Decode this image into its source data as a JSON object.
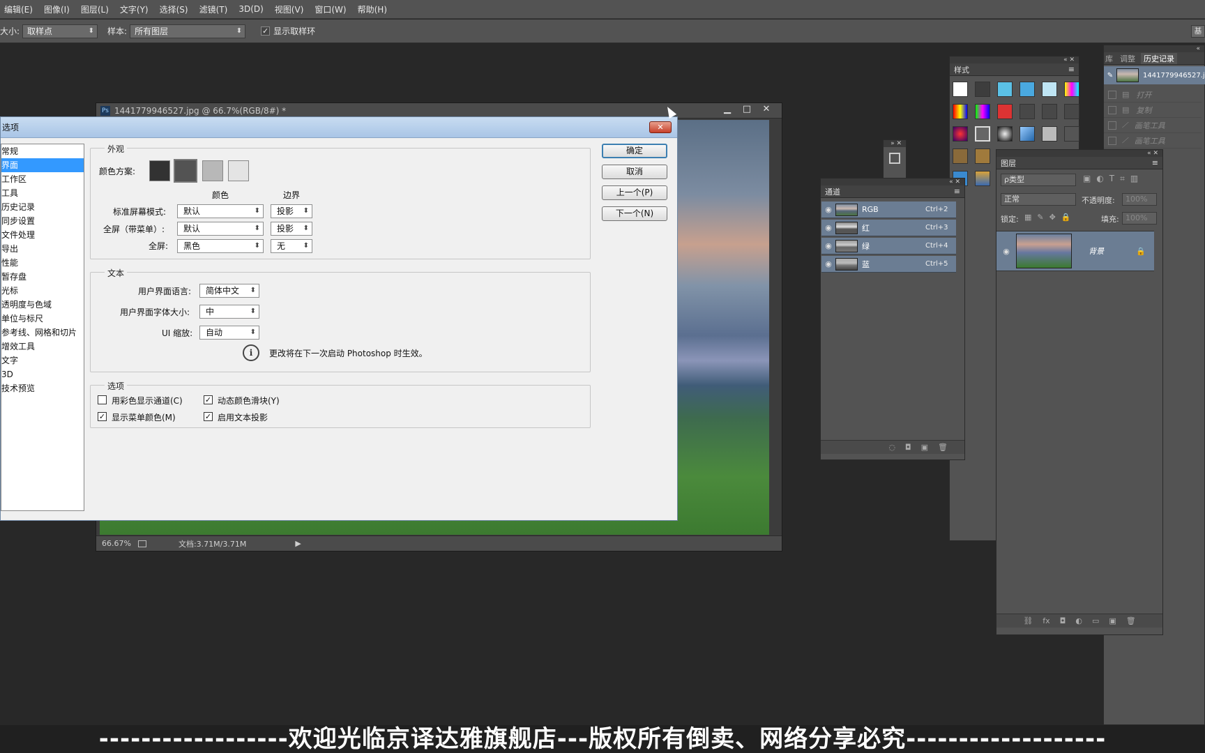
{
  "menu": [
    "编辑(E)",
    "图像(I)",
    "图层(L)",
    "文字(Y)",
    "选择(S)",
    "滤镜(T)",
    "3D(D)",
    "视图(V)",
    "窗口(W)",
    "帮助(H)"
  ],
  "options_bar": {
    "size_label": "大小:",
    "size_value": "取样点",
    "sample_label": "样本:",
    "sample_value": "所有图层",
    "show_ring_label": "显示取样环",
    "show_ring_checked": "✓",
    "right_btn": "基"
  },
  "document": {
    "title": "1441779946527.jpg @ 66.7%(RGB/8#) *",
    "ps_icon": "Ps",
    "minimize": "▁",
    "maximize": "□",
    "close": "✕",
    "zoom": "66.67%",
    "doc_size": "文档:3.71M/3.71M",
    "arrow": "▶"
  },
  "dialog": {
    "title": "选项",
    "close": "✕",
    "categories": [
      "常规",
      "界面",
      "工作区",
      "工具",
      "历史记录",
      "同步设置",
      "文件处理",
      "导出",
      "性能",
      "暂存盘",
      "光标",
      "透明度与色域",
      "单位与标尺",
      "参考线、网格和切片",
      "增效工具",
      "文字",
      "3D",
      "技术预览"
    ],
    "selected_category": "界面",
    "appearance": {
      "group_title": "外观",
      "color_scheme_label": "颜色方案:",
      "col_color": "颜色",
      "col_border": "边界",
      "rows": [
        {
          "label": "标准屏幕模式:",
          "color": "默认",
          "border": "投影"
        },
        {
          "label": "全屏（带菜单）:",
          "color": "默认",
          "border": "投影"
        },
        {
          "label": "全屏:",
          "color": "黑色",
          "border": "无"
        }
      ]
    },
    "text": {
      "group_title": "文本",
      "lang_label": "用户界面语言:",
      "lang_value": "简体中文",
      "fontsize_label": "用户界面字体大小:",
      "fontsize_value": "中",
      "scale_label": "UI 缩放:",
      "scale_value": "自动",
      "info_icon": "i",
      "notice": "更改将在下一次启动 Photoshop 时生效。"
    },
    "options": {
      "group_title": "选项",
      "items": [
        {
          "label": "用彩色显示通道(C)",
          "checked": ""
        },
        {
          "label": "动态颜色滑块(Y)",
          "checked": "✓"
        },
        {
          "label": "显示菜单颜色(M)",
          "checked": "✓"
        },
        {
          "label": "启用文本投影",
          "checked": "✓"
        }
      ]
    },
    "buttons": {
      "ok": "确定",
      "cancel": "取消",
      "prev": "上一个(P)",
      "next": "下一个(N)"
    }
  },
  "styles_panel": {
    "title": "样式",
    "menu_icon": "≡"
  },
  "channels_panel": {
    "title": "通道",
    "channels": [
      {
        "name": "RGB",
        "shortcut": "Ctrl+2"
      },
      {
        "name": "红",
        "shortcut": "Ctrl+3"
      },
      {
        "name": "绿",
        "shortcut": "Ctrl+4"
      },
      {
        "name": "蓝",
        "shortcut": "Ctrl+5"
      }
    ]
  },
  "history_panel": {
    "tabs": [
      "库",
      "调整",
      "历史记录"
    ],
    "snapshot_name": "1441779946527.j",
    "steps": [
      "打开",
      "复制",
      "画笔工具",
      "画笔工具"
    ]
  },
  "layers_panel": {
    "title": "图层",
    "filter_label": "ρ类型",
    "blend_mode": "正常",
    "opacity_label": "不透明度:",
    "opacity_value": "100%",
    "lock_label": "锁定:",
    "fill_label": "填充:",
    "fill_value": "100%",
    "layer_name": "背景",
    "footer_icons": [
      "⛓",
      "fx",
      "◘",
      "◐",
      "▭",
      "▣",
      "🗑"
    ]
  },
  "banner": "------------------欢迎光临京译达雅旗舰店---版权所有倒卖、网络分享必究-------------------"
}
